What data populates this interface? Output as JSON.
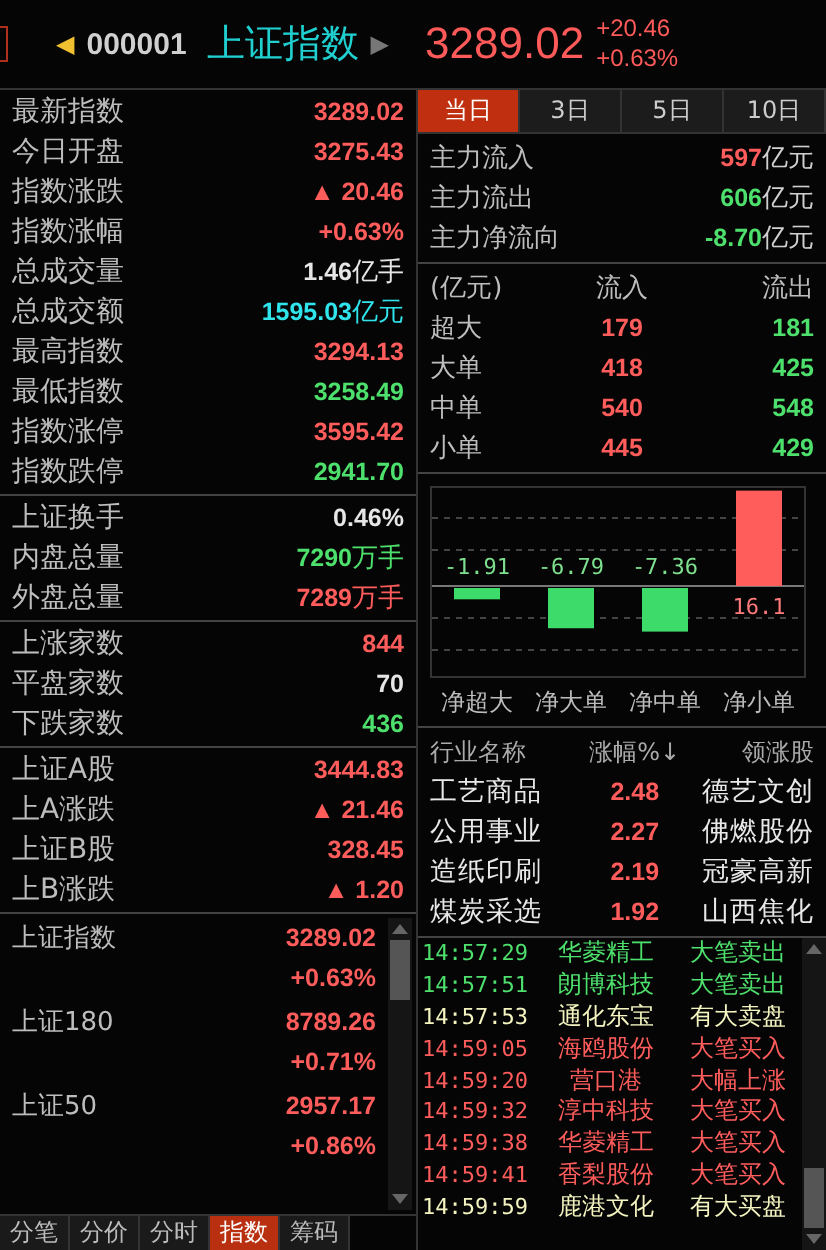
{
  "header": {
    "prev_arrow": "◀",
    "code": "000001",
    "name": "上证指数",
    "next_arrow": "▶",
    "price": "3289.02",
    "change": "+20.46",
    "change_pct": "+0.63%"
  },
  "quote_sections": [
    [
      {
        "label": "最新指数",
        "value": "3289.02",
        "color": "#ff5c5c"
      },
      {
        "label": "今日开盘",
        "value": "3275.43",
        "color": "#ff5c5c"
      },
      {
        "label": "指数涨跌",
        "value": "▲ 20.46",
        "color": "#ff5c5c"
      },
      {
        "label": "指数涨幅",
        "value": "+0.63%",
        "color": "#ff5c5c"
      },
      {
        "label": "总成交量",
        "value": "1.46",
        "unit": "亿手",
        "color": "#e6e6e6"
      },
      {
        "label": "总成交额",
        "value": "1595.03",
        "unit": "亿元",
        "color": "#30e4ec"
      },
      {
        "label": "最高指数",
        "value": "3294.13",
        "color": "#ff5c5c"
      },
      {
        "label": "最低指数",
        "value": "3258.49",
        "color": "#4ee06c"
      },
      {
        "label": "指数涨停",
        "value": "3595.42",
        "color": "#ff5c5c"
      },
      {
        "label": "指数跌停",
        "value": "2941.70",
        "color": "#4ee06c"
      }
    ],
    [
      {
        "label": "上证换手",
        "value": "0.46%",
        "color": "#e6e6e6"
      },
      {
        "label": "内盘总量",
        "value": "7290",
        "unit": "万手",
        "color": "#4ee06c"
      },
      {
        "label": "外盘总量",
        "value": "7289",
        "unit": "万手",
        "color": "#ff5c5c"
      }
    ],
    [
      {
        "label": "上涨家数",
        "value": "844",
        "color": "#ff5c5c"
      },
      {
        "label": "平盘家数",
        "value": "70",
        "color": "#e6e6e6"
      },
      {
        "label": "下跌家数",
        "value": "436",
        "color": "#4ee06c"
      }
    ],
    [
      {
        "label": "上证A股",
        "value": "3444.83",
        "color": "#ff5c5c"
      },
      {
        "label": "上A涨跌",
        "value": "▲ 21.46",
        "color": "#ff5c5c"
      },
      {
        "label": "上证B股",
        "value": "328.45",
        "color": "#ff5c5c"
      },
      {
        "label": "上B涨跌",
        "value": "▲ 1.20",
        "color": "#ff5c5c"
      }
    ]
  ],
  "index_list": [
    {
      "name": "上证指数",
      "value": "3289.02",
      "change": "+0.63%"
    },
    {
      "name": "上证180",
      "value": "8789.26",
      "change": "+0.71%"
    },
    {
      "name": "上证50",
      "value": "2957.17",
      "change": "+0.86%"
    }
  ],
  "bottom_tabs": [
    {
      "label": "分笔",
      "selected": false
    },
    {
      "label": "分价",
      "selected": false
    },
    {
      "label": "分时",
      "selected": false
    },
    {
      "label": "指数",
      "selected": true
    },
    {
      "label": "筹码",
      "selected": false
    }
  ],
  "period_tabs": [
    {
      "label": "当日",
      "selected": true
    },
    {
      "label": "3日",
      "selected": false
    },
    {
      "label": "5日",
      "selected": false
    },
    {
      "label": "10日",
      "selected": false
    }
  ],
  "main_flow": [
    {
      "label": "主力流入",
      "value": "597",
      "unit": "亿元",
      "color": "#ff5c5c"
    },
    {
      "label": "主力流出",
      "value": "606",
      "unit": "亿元",
      "color": "#4ee06c"
    },
    {
      "label": "主力净流向",
      "value": "-8.70",
      "unit": "亿元",
      "color": "#4ee06c"
    }
  ],
  "flow_table": {
    "columns": [
      "(亿元)",
      "流入",
      "流出"
    ],
    "rows": [
      {
        "name": "超大",
        "in": "179",
        "out": "181"
      },
      {
        "name": "大单",
        "in": "418",
        "out": "425"
      },
      {
        "name": "中单",
        "in": "540",
        "out": "548"
      },
      {
        "name": "小单",
        "in": "445",
        "out": "429"
      }
    ]
  },
  "net_flow_chart": {
    "chart_data": {
      "type": "bar",
      "categories": [
        "净超大",
        "净大单",
        "净中单",
        "净小单"
      ],
      "values": [
        -1.91,
        -6.79,
        -7.36,
        16.1
      ],
      "value_labels": [
        "-1.91",
        "-6.79",
        "-7.36",
        "16.1"
      ]
    }
  },
  "sector_table": {
    "columns": [
      "行业名称",
      "涨幅%↓",
      "领涨股"
    ],
    "rows": [
      {
        "sector": "工艺商品",
        "change": "2.48",
        "leader": "德艺文创"
      },
      {
        "sector": "公用事业",
        "change": "2.27",
        "leader": "佛燃股份"
      },
      {
        "sector": "造纸印刷",
        "change": "2.19",
        "leader": "冠豪高新"
      },
      {
        "sector": "煤炭采选",
        "change": "1.92",
        "leader": "山西焦化"
      }
    ]
  },
  "alerts": [
    {
      "time": "14:57:29",
      "stock": "华菱精工",
      "event": "大笔卖出",
      "color": "#4ee06c"
    },
    {
      "time": "14:57:51",
      "stock": "朗博科技",
      "event": "大笔卖出",
      "color": "#4ee06c"
    },
    {
      "time": "14:57:53",
      "stock": "通化东宝",
      "event": "有大卖盘",
      "color": "#f4f4c0"
    },
    {
      "time": "14:59:05",
      "stock": "海鸥股份",
      "event": "大笔买入",
      "color": "#ff5c5c"
    },
    {
      "time": "14:59:20",
      "stock": "营口港",
      "event": "大幅上涨",
      "color": "#ff5c5c"
    },
    {
      "time": "14:59:32",
      "stock": "淳中科技",
      "event": "大笔买入",
      "color": "#ff5c5c"
    },
    {
      "time": "14:59:38",
      "stock": "华菱精工",
      "event": "大笔买入",
      "color": "#ff5c5c"
    },
    {
      "time": "14:59:41",
      "stock": "香梨股份",
      "event": "大笔买入",
      "color": "#ff5c5c"
    },
    {
      "time": "14:59:59",
      "stock": "鹿港文化",
      "event": "有大买盘",
      "color": "#f4f4c0"
    }
  ]
}
